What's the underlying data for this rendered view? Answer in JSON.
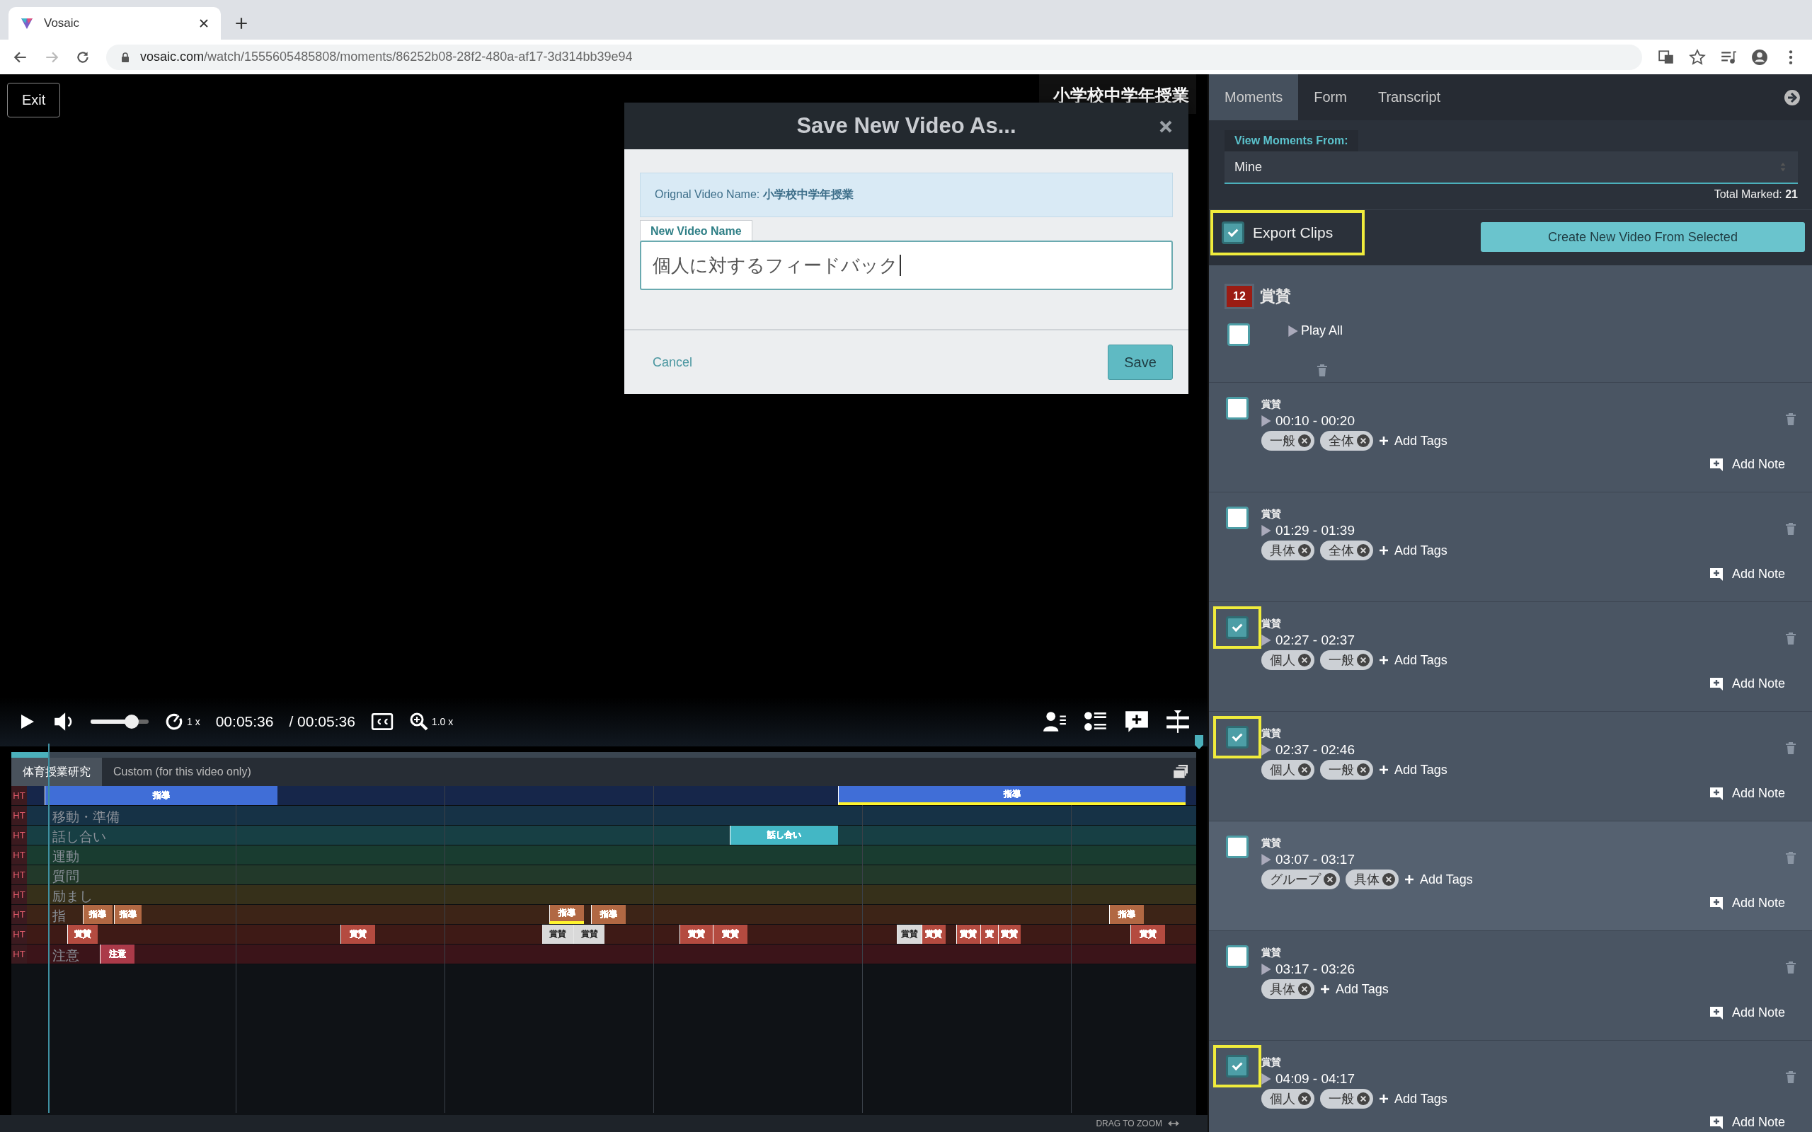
{
  "browser": {
    "tab": {
      "title": "Vosaic"
    },
    "url": {
      "host": "vosaic.com",
      "path": "/watch/1555605485808/moments/86252b08-28f2-480a-af17-3d314bb39e94"
    },
    "forward_disabled": true
  },
  "player": {
    "exit": "Exit",
    "video_title": "小学校中学年授業",
    "volume": {
      "level": 0.78
    },
    "speed": "1 x",
    "current_time": "00:05:36",
    "duration": "/ 00:05:36",
    "zoom": "1.0 x",
    "progress": {
      "level": 0.032
    }
  },
  "timeline": {
    "tabs": [
      {
        "label": "体育授業研究",
        "selected": true
      },
      {
        "label": "Custom (for this video only)",
        "selected": false
      }
    ],
    "rows": [
      {
        "tag": "HT",
        "color": "#16264a",
        "segments": [
          {
            "label": "指導",
            "marked": false,
            "light": false
          },
          {
            "label": "指導",
            "marked": true,
            "light": false
          }
        ]
      },
      {
        "tag": "HT",
        "name": "移動・準備",
        "color": "#163246",
        "segments": []
      },
      {
        "tag": "HT",
        "name": "話し合い",
        "color": "#173f44",
        "segments": [
          {
            "label": "話し合い",
            "marked": false,
            "light": false
          }
        ]
      },
      {
        "tag": "HT",
        "name": "運動",
        "color": "#193c30",
        "segments": []
      },
      {
        "tag": "HT",
        "name": "質問",
        "color": "#22392a",
        "segments": []
      },
      {
        "tag": "HT",
        "name": "励まし",
        "color": "#36301a",
        "segments": []
      },
      {
        "tag": "HT",
        "name": "指",
        "color": "#3d2417",
        "segments": [
          {
            "label": "指導",
            "marked": false,
            "light": false
          },
          {
            "label": "指導",
            "marked": false,
            "light": false
          },
          {
            "label": "指導",
            "marked": true,
            "light": false
          },
          {
            "label": "指導",
            "marked": false,
            "light": false
          },
          {
            "label": "指導",
            "marked": false,
            "light": false
          }
        ]
      },
      {
        "tag": "HT",
        "color": "#3e1a16",
        "segments": [
          {
            "label": "賞賛",
            "marked": false,
            "light": false
          },
          {
            "label": "賞賛",
            "marked": false,
            "light": false
          },
          {
            "label": "賞賛",
            "marked": false,
            "light": true
          },
          {
            "label": "賞賛",
            "marked": false,
            "light": true
          },
          {
            "label": "賞賛",
            "marked": false,
            "light": false
          },
          {
            "label": "賞賛",
            "marked": false,
            "light": false
          },
          {
            "label": "賞賛",
            "marked": false,
            "light": true
          },
          {
            "label": "賞賛",
            "marked": false,
            "light": false
          },
          {
            "label": "賞賛",
            "marked": false,
            "light": false
          },
          {
            "label": "賞",
            "marked": false,
            "light": false
          },
          {
            "label": "賞賛",
            "marked": false,
            "light": false
          },
          {
            "label": "賞賛",
            "marked": false,
            "light": false
          }
        ]
      },
      {
        "tag": "HT",
        "name": "注意",
        "color": "#3b1419",
        "segments": [
          {
            "label": "注意",
            "marked": false,
            "light": false
          }
        ]
      }
    ],
    "footer": "DRAG TO ZOOM"
  },
  "dialog": {
    "title": "Save New Video As...",
    "info": "Orignal Video Name: **小学校中学年授業**",
    "field": {
      "label": "New Video Name",
      "value": "個人に対するフィードバック"
    },
    "cancel": "Cancel",
    "save": "Save"
  },
  "panel": {
    "tabs": [
      {
        "label": "Moments",
        "selected": true
      },
      {
        "label": "Form",
        "selected": false
      },
      {
        "label": "Transcript",
        "selected": false
      }
    ],
    "view_from": {
      "label": "View Moments From:",
      "value": "Mine"
    },
    "total": "Total Marked: **21**",
    "export": {
      "label": "Export Clips",
      "checked": true,
      "highlighted": true
    },
    "create": "Create New Video From Selected",
    "group": {
      "count": "12",
      "color": "#9b1c14",
      "name": "賞賛"
    },
    "play_all": {
      "label": "Play All",
      "checked": false
    },
    "moments": [
      {
        "category": "賞賛",
        "time": "00:10 - 00:20",
        "tags": [
          "一般",
          "全体"
        ],
        "add_tags": "Add Tags",
        "add_note": "Add Note",
        "checked": false,
        "highlighted": false,
        "hovered": false
      },
      {
        "category": "賞賛",
        "time": "01:29 - 01:39",
        "tags": [
          "具体",
          "全体"
        ],
        "add_tags": "Add Tags",
        "add_note": "Add Note",
        "checked": false,
        "highlighted": false,
        "hovered": false
      },
      {
        "category": "賞賛",
        "time": "02:27 - 02:37",
        "tags": [
          "個人",
          "一般"
        ],
        "add_tags": "Add Tags",
        "add_note": "Add Note",
        "checked": true,
        "highlighted": true,
        "hovered": false
      },
      {
        "category": "賞賛",
        "time": "02:37 - 02:46",
        "tags": [
          "個人",
          "一般"
        ],
        "add_tags": "Add Tags",
        "add_note": "Add Note",
        "checked": true,
        "highlighted": true,
        "hovered": false
      },
      {
        "category": "賞賛",
        "time": "03:07 - 03:17",
        "tags": [
          "グループ",
          "具体"
        ],
        "add_tags": "Add Tags",
        "add_note": "Add Note",
        "checked": false,
        "highlighted": false,
        "hovered": true
      },
      {
        "category": "賞賛",
        "time": "03:17 - 03:26",
        "tags": [
          "具体"
        ],
        "add_tags": "Add Tags",
        "add_note": "Add Note",
        "checked": false,
        "highlighted": false,
        "hovered": false
      },
      {
        "category": "賞賛",
        "time": "04:09 - 04:17",
        "tags": [
          "個人",
          "一般"
        ],
        "add_tags": "Add Tags",
        "add_note": "Add Note",
        "checked": true,
        "highlighted": true,
        "hovered": false
      }
    ]
  }
}
